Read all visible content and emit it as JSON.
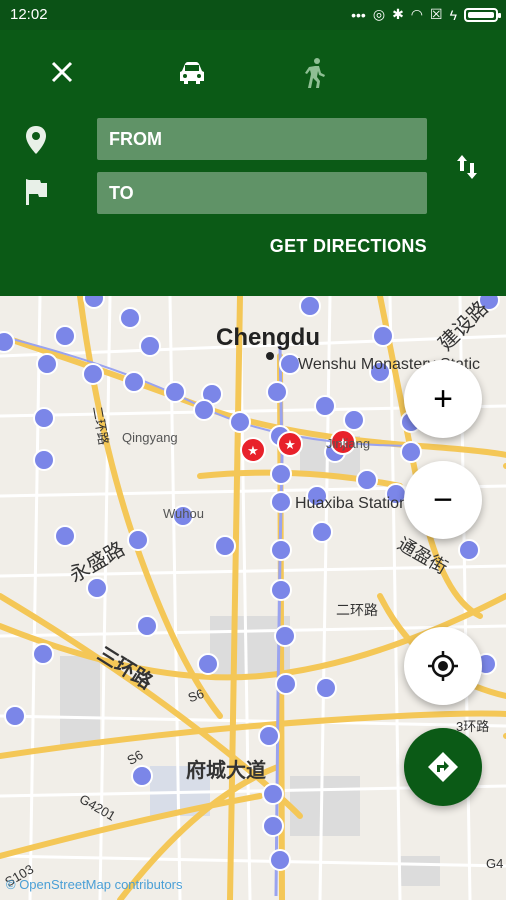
{
  "status_bar": {
    "time": "12:02",
    "icons": [
      "more-dots",
      "data-saver",
      "bluetooth",
      "wifi",
      "sim-off",
      "charging",
      "battery"
    ]
  },
  "header": {
    "close_icon": "close-icon",
    "car_icon": "car-icon",
    "walk_icon": "walk-icon",
    "from_placeholder": "FROM",
    "to_placeholder": "TO",
    "swap_icon": "swap-vertical-icon",
    "get_directions_label": "GET DIRECTIONS"
  },
  "map": {
    "labels": {
      "city": "Chengdu",
      "wenshu": "Wenshu Monastery Static",
      "qingyang": "Qingyang",
      "wuhou": "Wuhou",
      "jinjiang": "Jinjiang",
      "huaxiba": "Huaxiba Station",
      "yongsheng": "永盛路",
      "sanhuan": "三环路",
      "tongying": "通盈街",
      "erhuan": "二环路",
      "erhuan_v": "二环路",
      "fucheng": "府城大道",
      "jianshe": "建设路",
      "sanhuan2": "3环路",
      "s6": "S6",
      "s6b": "S6",
      "g4201": "G4201",
      "s103": "S103",
      "g4": "G4"
    },
    "attribution": "© OpenStreetMap contributors"
  },
  "controls": {
    "zoom_in": "+",
    "zoom_out": "−"
  },
  "colors": {
    "header_green": "#0b5a16",
    "station_blue": "#7b86e8",
    "star_red": "#e8212a",
    "road_yellow": "#f4c757"
  }
}
